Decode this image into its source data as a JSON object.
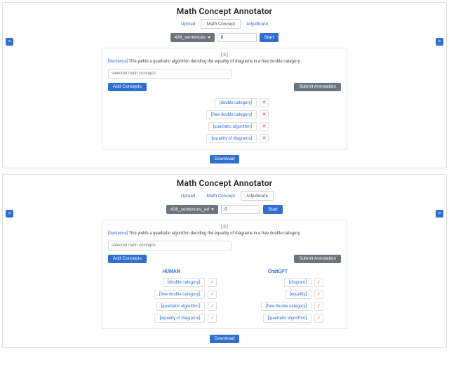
{
  "app_title": "Math Concept Annotator",
  "tabs": {
    "upload": "Upload",
    "math_concept": "Math Concept",
    "adjudicate": "Adjudicate"
  },
  "controls": {
    "dropdown_top": "436_sentences",
    "dropdown_bottom": "438_sentences_ad",
    "index_value": "0",
    "start": "Start"
  },
  "nav": {
    "prev": "<",
    "next": ">"
  },
  "sentence": {
    "id_label": "[ 0 ]",
    "label_prefix": "[Sentence]",
    "text": "This yields a quadratic algorithm deciding the equality of diagrams in a free double category."
  },
  "inputs": {
    "selected_placeholder": "selected math concepts"
  },
  "buttons": {
    "add_concepts": "Add Concepts",
    "submit": "Submit Annotation",
    "download": "Download"
  },
  "concepts_single": [
    "[double category]",
    "[free double category]",
    "[quadratic algorithm]",
    "[equality of diagrams]"
  ],
  "columns": {
    "human_title": "HUMAN",
    "chatgpt_title": "ChatGPT",
    "human": [
      "[double category]",
      "[free double category]",
      "[quadratic algorithm]",
      "[equality of diagrams]"
    ],
    "chatgpt": [
      "[diagram]",
      "[equality]",
      "[free double category]",
      "[quadratic algorithm]"
    ]
  }
}
